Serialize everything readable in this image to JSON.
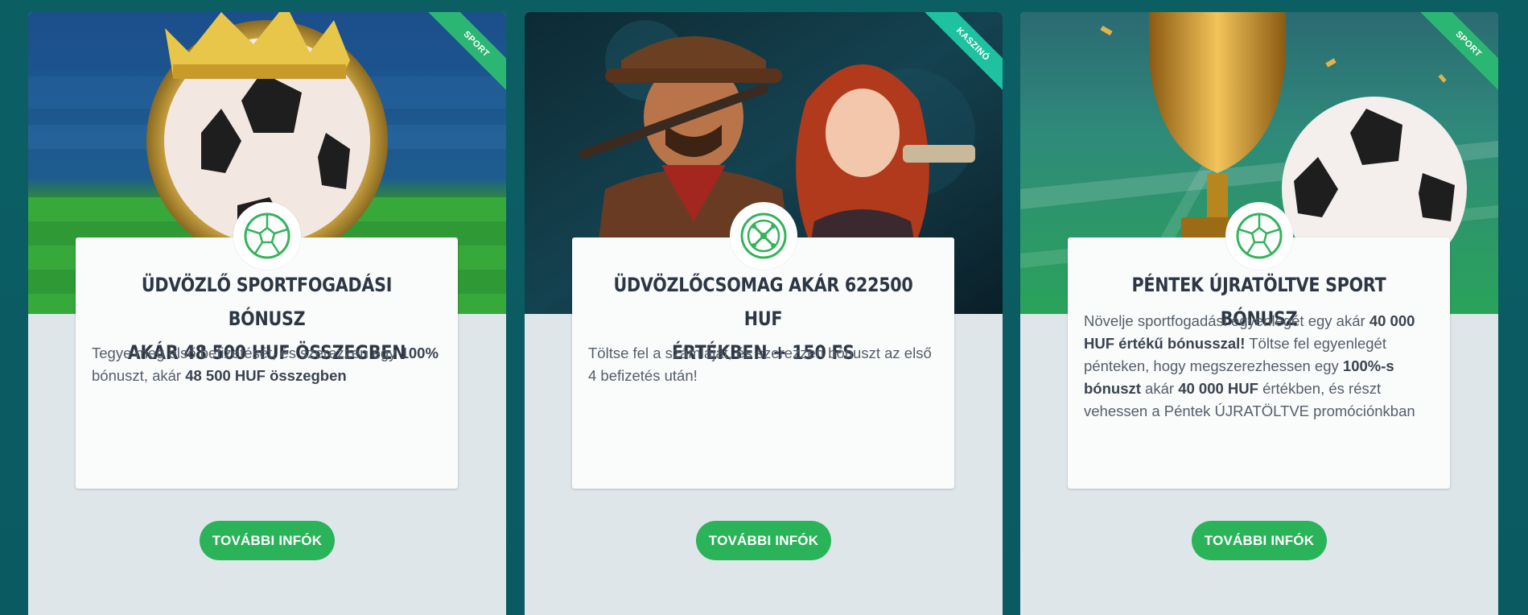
{
  "cards": [
    {
      "ribbon": "SPORT",
      "title_line1": "ÜDVÖZLŐ SPORTFOGADÁSI BÓNUSZ",
      "title_line2": "AKÁR 48 500 HUF ÖSSZEGBEN",
      "text": [
        {
          "t": "Tegye meg első befizetését, és szerezzen egy ",
          "b": false
        },
        {
          "t": "100%",
          "b": true
        },
        {
          "t": " bónuszt, akár ",
          "b": false
        },
        {
          "t": "48 500 HUF összegben",
          "b": true
        }
      ],
      "button": "TOVÁBBI INFÓK",
      "icon": "soccer-ball-icon"
    },
    {
      "ribbon": "KASZINÓ",
      "title_line1": "ÜDVÖZLŐCSOMAG AKÁR 622500 HUF",
      "title_line2": "ÉRTÉKBEN + 150 FS",
      "text": [
        {
          "t": "Töltse fel a számláját, és szerezzen bónuszt az első 4 befizetés után!",
          "b": false
        }
      ],
      "button": "TOVÁBBI INFÓK",
      "icon": "roulette-icon"
    },
    {
      "ribbon": "SPORT",
      "title_line1": "PÉNTEK ÚJRATÖLTVE SPORT BÓNUSZ",
      "title_line2": "",
      "text": [
        {
          "t": "Növelje sportfogadási egyenlegét egy akár ",
          "b": false
        },
        {
          "t": "40 000 HUF értékű bónusszal!",
          "b": true
        },
        {
          "t": " Töltse fel egyenlegét pénteken, hogy megszerezhessen egy ",
          "b": false
        },
        {
          "t": "100%-s bónuszt",
          "b": true
        },
        {
          "t": " akár ",
          "b": false
        },
        {
          "t": "40 000 HUF",
          "b": true
        },
        {
          "t": " értékben, és részt vehessen a Péntek ÚJRATÖLTVE promóciónkban",
          "b": false
        }
      ],
      "button": "TOVÁBBI INFÓK",
      "icon": "soccer-ball-icon"
    }
  ],
  "colors": {
    "background": "#0b5f63",
    "card": "#dfe6ea",
    "button": "#2bb35a",
    "ribbon_sport": "#2bb673",
    "ribbon_casino": "#1fc2a0",
    "icon": "#33b35a"
  }
}
